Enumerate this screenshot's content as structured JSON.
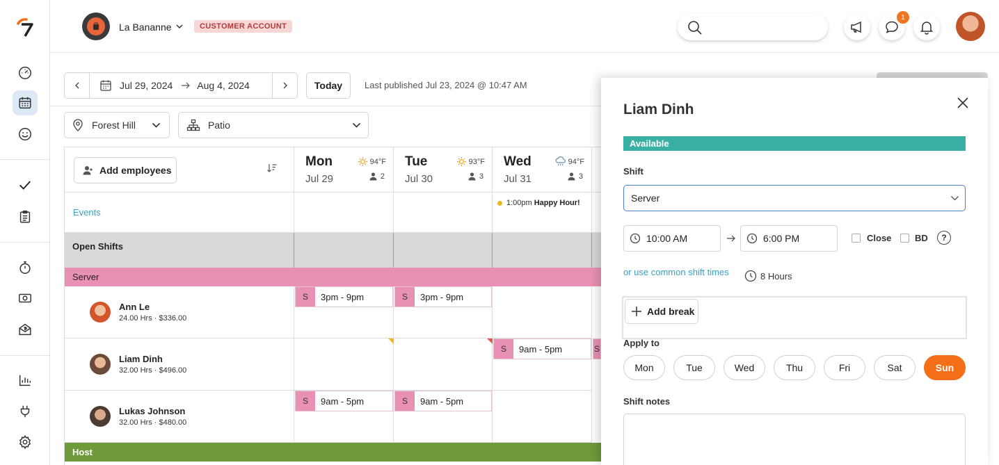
{
  "header": {
    "org_name": "La Bananne",
    "account_badge": "CUSTOMER ACCOUNT",
    "messages_badge": "1",
    "search_placeholder": ""
  },
  "toolbar": {
    "start_date": "Jul 29, 2024",
    "end_date": "Aug 4, 2024",
    "today_label": "Today",
    "published": "Last published Jul 23, 2024 @ 10:47 AM",
    "location": "Forest Hill",
    "area": "Patio"
  },
  "grid": {
    "add_employees_label": "Add employees",
    "events_label": "Events",
    "open_shifts_label": "Open Shifts",
    "days": [
      {
        "name": "Mon",
        "date": "Jul 29",
        "temp": "94°F",
        "staff": "2",
        "weather_icon": "sun-icon"
      },
      {
        "name": "Tue",
        "date": "Jul 30",
        "temp": "93°F",
        "staff": "3",
        "weather_icon": "sun-icon"
      },
      {
        "name": "Wed",
        "date": "Jul 31",
        "temp": "94°F",
        "staff": "3",
        "weather_icon": "rain-cloud-icon"
      }
    ],
    "event": {
      "time": "1:00pm",
      "name": "Happy Hour!"
    },
    "roles": [
      {
        "name": "Server",
        "color": "#e991b4"
      },
      {
        "name": "Host",
        "color": "#6f9a3a"
      }
    ],
    "employees": [
      {
        "name": "Ann Le",
        "meta": "24.00 Hrs · $336.00"
      },
      {
        "name": "Liam Dinh",
        "meta": "32.00 Hrs · $496.00"
      },
      {
        "name": "Lukas Johnson",
        "meta": "32.00 Hrs · $480.00"
      }
    ],
    "shift_tag": "S",
    "shifts": {
      "ann_mon": "3pm - 9pm",
      "ann_tue": "3pm - 9pm",
      "liam_wed": "9am - 5pm",
      "lukas_mon": "9am - 5pm",
      "lukas_tue": "9am - 5pm"
    }
  },
  "panel": {
    "title": "Liam Dinh",
    "availability": "Available",
    "shift_label": "Shift",
    "shift_value": "Server",
    "start_time": "10:00 AM",
    "end_time": "6:00 PM",
    "close_label": "Close",
    "bd_label": "BD",
    "help_glyph": "?",
    "common_times_link": "or use common shift times",
    "duration": "8 Hours",
    "add_break_label": "Add break",
    "apply_to_label": "Apply to",
    "apply_days": [
      "Mon",
      "Tue",
      "Wed",
      "Thu",
      "Fri",
      "Sat",
      "Sun"
    ],
    "selected_day": "Sun",
    "notes_label": "Shift notes",
    "notes_value": ""
  },
  "colors": {
    "accent_orange": "#f46f17",
    "available_teal": "#38b0a4",
    "server_pink": "#e991b4",
    "host_green": "#6f9a3a",
    "link_blue": "#3aa0c8"
  }
}
